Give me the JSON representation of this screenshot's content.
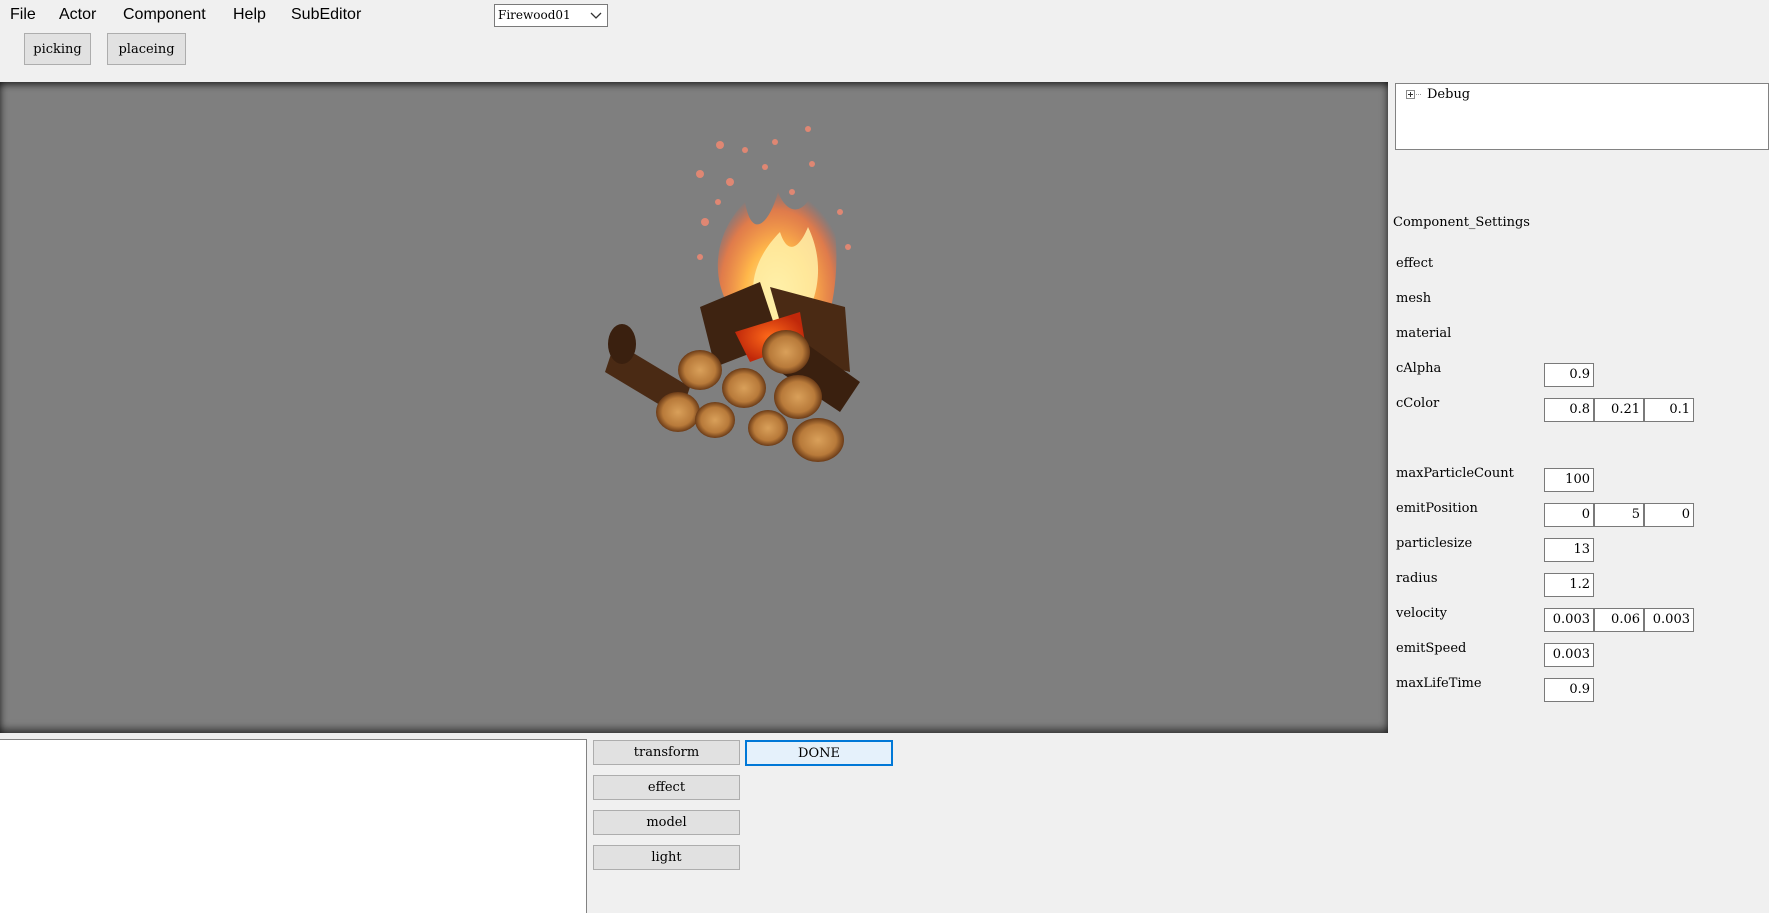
{
  "menu": {
    "items": [
      "File",
      "Actor",
      "Component",
      "Help",
      "SubEditor"
    ],
    "actor_select": "Firewood01"
  },
  "toolbar": {
    "picking_label": "picking",
    "placeing_label": "placeing"
  },
  "tree": {
    "node_label": "Debug"
  },
  "component_settings": {
    "title": "Component_Settings",
    "effect_label": "effect",
    "mesh_label": "mesh",
    "material_label": "material",
    "calpha_label": "cAlpha",
    "calpha_value": "0.9",
    "ccolor_label": "cColor",
    "ccolor_values": [
      "0.8",
      "0.21",
      "0.1"
    ],
    "maxparticlecount_label": "maxParticleCount",
    "maxparticlecount_value": "100",
    "emitposition_label": "emitPosition",
    "emitposition_values": [
      "0",
      "5",
      "0"
    ],
    "particlesize_label": "particlesize",
    "particlesize_value": "13",
    "radius_label": "radius",
    "radius_value": "1.2",
    "velocity_label": "velocity",
    "velocity_values": [
      "0.003",
      "0.06",
      "0.003"
    ],
    "emitspeed_label": "emitSpeed",
    "emitspeed_value": "0.003",
    "maxlifetime_label": "maxLifeTime",
    "maxlifetime_value": "0.9"
  },
  "components": {
    "transform_label": "transform",
    "effect_label": "effect",
    "model_label": "model",
    "light_label": "light",
    "done_label": "DONE"
  },
  "icons": {
    "expander": "plus-box-icon",
    "dropdown": "chevron-down-icon"
  },
  "colors": {
    "viewport_bg": "#7f7f7f",
    "done_border": "#0078d7"
  }
}
